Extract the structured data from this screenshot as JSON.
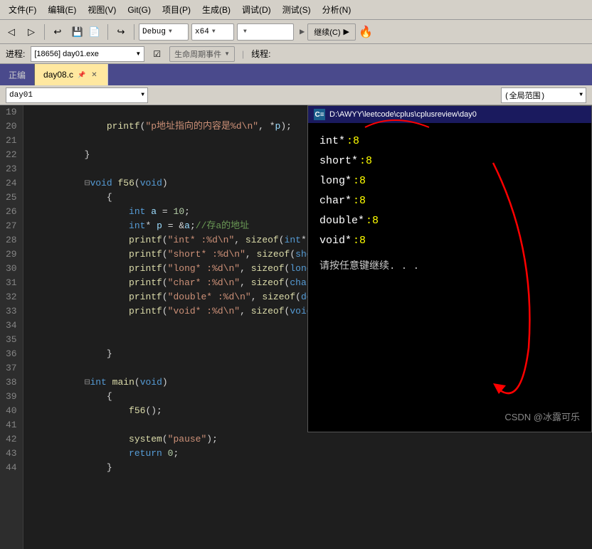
{
  "menubar": {
    "items": [
      "文件(F)",
      "编辑(E)",
      "视图(V)",
      "Git(G)",
      "项目(P)",
      "生成(B)",
      "调试(D)",
      "测试(S)",
      "分析(N)"
    ]
  },
  "toolbar": {
    "debug_config": "Debug",
    "platform": "x64",
    "continue_label": "继续(C)"
  },
  "processbar": {
    "label": "进程:",
    "process": "[18656] day01.exe",
    "lifecycle_label": "生命周期事件",
    "thread_label": "线程:"
  },
  "tabbar": {
    "inactive_tab": "正编",
    "active_tab": "day08.c"
  },
  "codeheader": {
    "scope_left": "day01",
    "scope_right": "(全局范围)"
  },
  "lines": [
    {
      "num": 19,
      "content": "    printf(\"p地址指向的内容是%d\\n\", *p);"
    },
    {
      "num": 20,
      "content": ""
    },
    {
      "num": 21,
      "content": "}"
    },
    {
      "num": 22,
      "content": ""
    },
    {
      "num": 23,
      "content": "□void f56(void)",
      "collapse": true
    },
    {
      "num": 24,
      "content": "    {"
    },
    {
      "num": 25,
      "content": "        int a = 10;"
    },
    {
      "num": 26,
      "content": "        int* p = &a;//存a的地址"
    },
    {
      "num": 27,
      "content": "        printf(\"int* :%d\\n\", sizeof(int*));"
    },
    {
      "num": 28,
      "content": "        printf(\"short* :%d\\n\", sizeof(short*));"
    },
    {
      "num": 29,
      "content": "        printf(\"long* :%d\\n\", sizeof(long*));"
    },
    {
      "num": 30,
      "content": "        printf(\"char* :%d\\n\", sizeof(char*));"
    },
    {
      "num": 31,
      "content": "        printf(\"double* :%d\\n\", sizeof(double*));"
    },
    {
      "num": 32,
      "content": "        printf(\"void* :%d\\n\", sizeof(void*));"
    },
    {
      "num": 33,
      "content": ""
    },
    {
      "num": 34,
      "content": ""
    },
    {
      "num": 35,
      "content": "    }"
    },
    {
      "num": 36,
      "content": ""
    },
    {
      "num": 37,
      "content": "□int main(void)",
      "collapse": true
    },
    {
      "num": 38,
      "content": "    {"
    },
    {
      "num": 39,
      "content": "        f56();"
    },
    {
      "num": 40,
      "content": ""
    },
    {
      "num": 41,
      "content": "        system(\"pause\");"
    },
    {
      "num": 42,
      "content": "        return 0;"
    },
    {
      "num": 43,
      "content": "    }"
    },
    {
      "num": 44,
      "content": ""
    }
  ],
  "terminal": {
    "titlebar": "D:\\AWYY\\leetcode\\cplus\\cplusreview\\day0",
    "lines": [
      {
        "label": "int* ",
        "value": ":8"
      },
      {
        "label": "short*",
        "value": ":8"
      },
      {
        "label": "long*",
        "value": " :8"
      },
      {
        "label": "char*",
        "value": " :8"
      },
      {
        "label": "double*",
        "value": " :8"
      },
      {
        "label": "void*",
        "value": "  :8"
      }
    ],
    "prompt": "请按任意键继续. . ."
  },
  "watermark": "CSDN @冰露可乐"
}
